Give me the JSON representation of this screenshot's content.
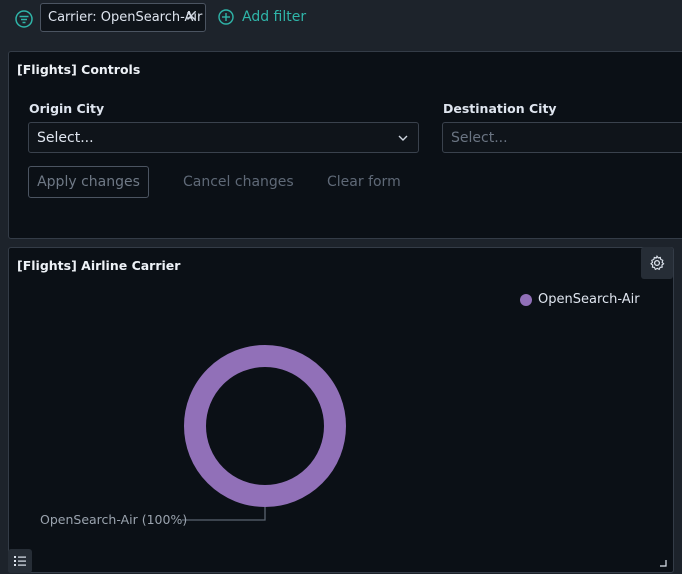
{
  "filter_bar": {
    "pill_label": "Carrier: OpenSearch-Air",
    "add_filter_label": "Add filter"
  },
  "controls_panel": {
    "title": "[Flights] Controls",
    "origin": {
      "label": "Origin City",
      "placeholder": "Select..."
    },
    "destination": {
      "label": "Destination City",
      "placeholder": "Select..."
    },
    "apply_label": "Apply changes",
    "cancel_label": "Cancel changes",
    "clear_label": "Clear form"
  },
  "carrier_panel": {
    "title": "[Flights] Airline Carrier"
  },
  "chart_data": {
    "type": "pie",
    "donut": true,
    "slices": [
      {
        "label": "OpenSearch-Air",
        "value": 100,
        "color": "#9170b8",
        "display_label": "OpenSearch-Air (100%)"
      }
    ],
    "legend": [
      "OpenSearch-Air"
    ],
    "legend_position": "top-right"
  },
  "colors": {
    "accent": "#2fb5a9",
    "slice": "#9170b8",
    "panel_bg": "#0b1016",
    "page_bg": "#1d232b"
  }
}
